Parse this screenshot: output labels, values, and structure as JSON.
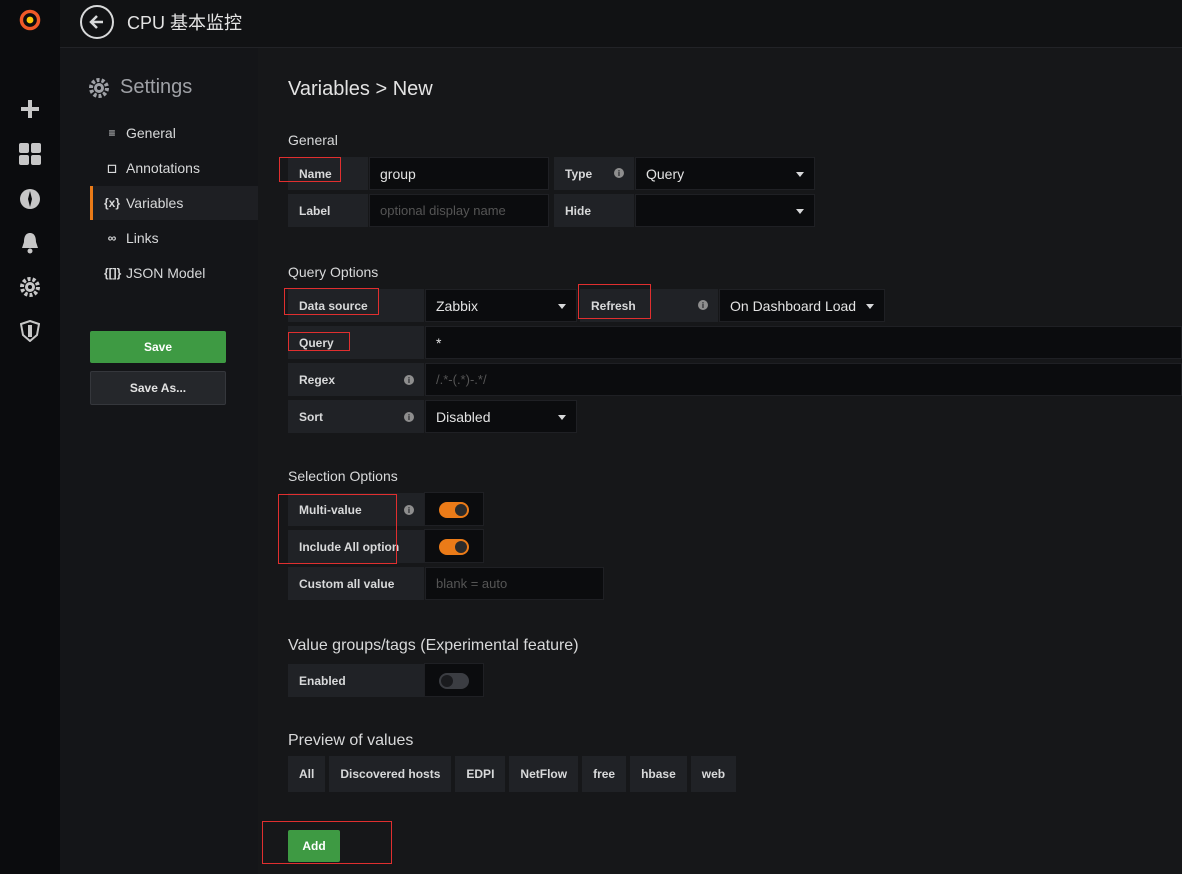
{
  "header": {
    "title": "CPU 基本监控"
  },
  "sidebar": {
    "title": "Settings",
    "items": [
      {
        "label": "General",
        "glyph": "≡"
      },
      {
        "label": "Annotations",
        "glyph": "◻"
      },
      {
        "label": "Variables",
        "glyph": "{x}"
      },
      {
        "label": "Links",
        "glyph": "∞"
      },
      {
        "label": "JSON Model",
        "glyph": "{[]}"
      }
    ],
    "save_label": "Save",
    "save_as_label": "Save As..."
  },
  "main": {
    "title": "Variables > New",
    "general": {
      "heading": "General",
      "name_label": "Name",
      "name_value": "group",
      "type_label": "Type",
      "type_value": "Query",
      "label_label": "Label",
      "label_placeholder": "optional display name",
      "hide_label": "Hide",
      "hide_value": ""
    },
    "query_options": {
      "heading": "Query Options",
      "datasource_label": "Data source",
      "datasource_value": "Zabbix",
      "refresh_label": "Refresh",
      "refresh_value": "On Dashboard Load",
      "query_label": "Query",
      "query_value": "*",
      "regex_label": "Regex",
      "regex_placeholder": "/.*-(.*)-.*/",
      "sort_label": "Sort",
      "sort_value": "Disabled"
    },
    "selection_options": {
      "heading": "Selection Options",
      "multi_value_label": "Multi-value",
      "multi_value": true,
      "include_all_label": "Include All option",
      "include_all": true,
      "custom_all_label": "Custom all value",
      "custom_all_placeholder": "blank = auto"
    },
    "value_groups": {
      "heading": "Value groups/tags (Experimental feature)",
      "enabled_label": "Enabled",
      "enabled": false
    },
    "preview": {
      "heading": "Preview of values",
      "values": [
        "All",
        "Discovered hosts",
        "EDPI",
        "NetFlow",
        "free",
        "hbase",
        "web"
      ]
    },
    "add_label": "Add"
  },
  "colors": {
    "accent": "#eb7b18",
    "primary_button": "#3e9a43",
    "highlight_box": "#e02f2f"
  }
}
